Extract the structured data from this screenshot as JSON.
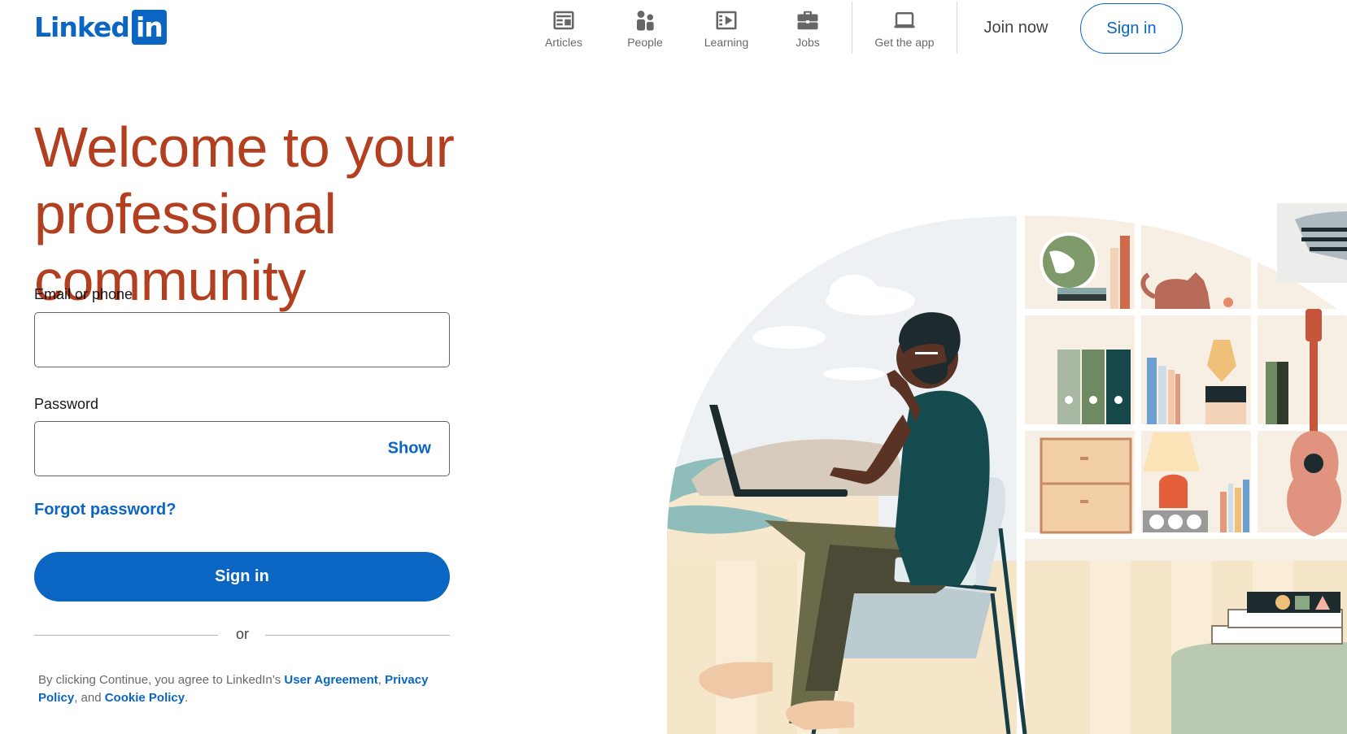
{
  "header": {
    "logo_text": "Linked",
    "logo_box_text": "in",
    "nav": [
      {
        "label": "Articles",
        "icon": "articles-icon"
      },
      {
        "label": "People",
        "icon": "people-icon"
      },
      {
        "label": "Learning",
        "icon": "learning-icon"
      },
      {
        "label": "Jobs",
        "icon": "jobs-icon"
      },
      {
        "label": "Get the app",
        "icon": "get-app-icon"
      }
    ],
    "join_label": "Join now",
    "signin_label": "Sign in"
  },
  "hero": {
    "title_line1": "Welcome to your",
    "title_line2": "professional community"
  },
  "form": {
    "email_label": "Email or phone",
    "email_value": "",
    "password_label": "Password",
    "password_value": "",
    "show_label": "Show",
    "forgot_label": "Forgot password?",
    "signin_label": "Sign in",
    "or_label": "or"
  },
  "legal": {
    "prefix": "By clicking Continue, you agree to LinkedIn’s ",
    "user_agreement": "User Agreement",
    "sep1": ", ",
    "privacy_policy": "Privacy Policy",
    "sep2": ", and ",
    "cookie_policy": "Cookie Policy",
    "suffix": "."
  },
  "colors": {
    "brand": "#0a66c2",
    "headline": "#b24020"
  }
}
